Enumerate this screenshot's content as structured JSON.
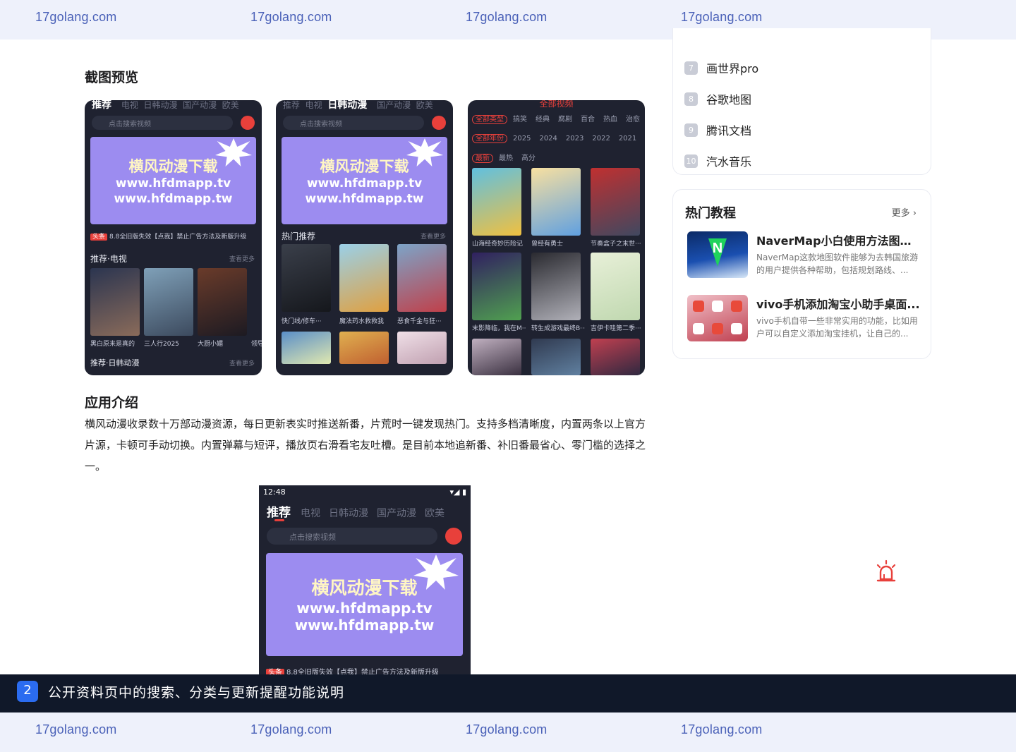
{
  "watermark": "17golang.com",
  "screenshots_section": {
    "title": "截图预览"
  },
  "shot1": {
    "tabs": [
      "推荐",
      "电视",
      "日韩动漫",
      "国产动漫",
      "欧美"
    ],
    "search_placeholder": "点击搜索视频",
    "banner": [
      "横风动漫下载",
      "www.hfdmapp.tv",
      "www.hfdmapp.tw"
    ],
    "notice_tag": "头条",
    "notice": "8.8全旧版失效【点我】禁止广告方法及新版升级",
    "row1_title": "推荐·电视",
    "row_more": "查看更多",
    "captions": [
      "黑白原来是真的",
      "三人行2025",
      "大厨小媚",
      "领导"
    ],
    "row2_title": "推荐·日韩动漫"
  },
  "shot2": {
    "tabs": [
      "推荐",
      "电视",
      "日韩动漫",
      "国产动漫",
      "欧美"
    ],
    "search_placeholder": "点击搜索视频",
    "banner": [
      "横风动漫下载",
      "www.hfdmapp.tv",
      "www.hfdmapp.tw"
    ],
    "row_title": "热门推荐",
    "row_more": "查看更多",
    "captions": [
      "快门线/修车···",
      "魔法药水救救我",
      "恶食千金与狂···"
    ]
  },
  "shot3": {
    "top_title": "全部视频",
    "filter1": [
      "全部类型",
      "搞笑",
      "经典",
      "腐剧",
      "百合",
      "热血",
      "治愈"
    ],
    "filter2": [
      "全部年份",
      "2025",
      "2024",
      "2023",
      "2022",
      "2021",
      "20"
    ],
    "filter3": [
      "最新",
      "最热",
      "高分"
    ],
    "captions1": [
      "山海经奇妙历险记",
      "曾经有勇士",
      "节奏盒子之末世···"
    ],
    "captions2": [
      "末影降临，我在M···",
      "转生成游戏最终B···",
      "吉伊卡哇第二季···"
    ]
  },
  "intro": {
    "title": "应用介绍",
    "body": "横风动漫收录数十万部动漫资源，每日更新表实时推送新番，片荒时一键发现热门。支持多档清晰度，内置两条以上官方片源，卡顿可手动切换。内置弹幕与短评，播放页右滑看宅友吐槽。是目前本地追新番、补旧番最省心、零门槛的选择之一。"
  },
  "bigshot": {
    "time": "12:48",
    "tabs": [
      "推荐",
      "电视",
      "日韩动漫",
      "国产动漫",
      "欧美"
    ],
    "search_placeholder": "点击搜索视频",
    "banner": [
      "横风动漫下载",
      "www.hfdmapp.tv",
      "www.hfdmapp.tw"
    ],
    "notice_tag": "头条",
    "notice": "8.8全旧版失效【点我】禁止广告方法及新版升级"
  },
  "rank": {
    "items": [
      {
        "num": "7",
        "label": "画世界pro"
      },
      {
        "num": "8",
        "label": "谷歌地图"
      },
      {
        "num": "9",
        "label": "腾讯文档"
      },
      {
        "num": "10",
        "label": "汽水音乐"
      }
    ]
  },
  "tutorials": {
    "title": "热门教程",
    "more": "更多",
    "items": [
      {
        "title": "NaverMap小白使用方法图文...",
        "desc": "NaverMap这款地图软件能够为去韩国旅游的用户提供各种帮助，包括规划路线、..."
      },
      {
        "title": "vivo手机添加淘宝小助手桌面...",
        "desc": "vivo手机自带一些非常实用的功能，比如用户可以自定义添加淘宝挂机，让自己的..."
      }
    ]
  },
  "caption": {
    "num": "2",
    "text": "公开资料页中的搜索、分类与更新提醒功能说明"
  },
  "colors": {
    "accent_red": "#e8403b",
    "watermark_blue": "#4a61b8",
    "caption_bg": "#101829",
    "badge_blue": "#2b6cf0"
  }
}
